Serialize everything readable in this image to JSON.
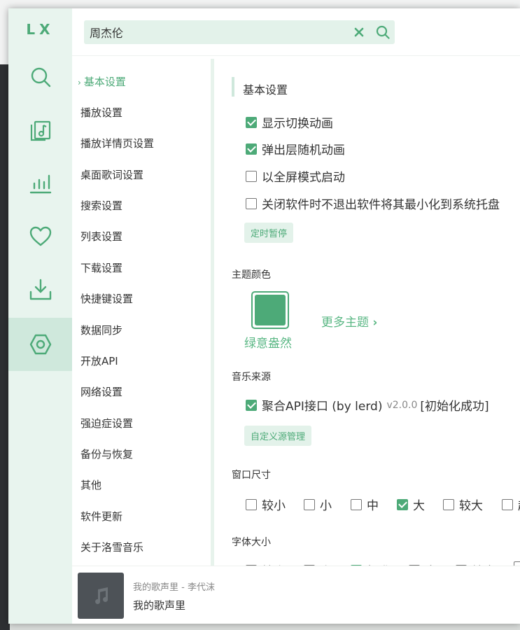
{
  "app": {
    "logo": "LX",
    "accent": "#4daa78",
    "accent_light": "#e3f2ea"
  },
  "nav": [
    {
      "name": "search",
      "icon": "search-icon"
    },
    {
      "name": "songlist",
      "icon": "music-note-icon"
    },
    {
      "name": "leaderboard",
      "icon": "bar-chart-icon"
    },
    {
      "name": "my-list",
      "icon": "heart-icon"
    },
    {
      "name": "download",
      "icon": "download-icon"
    },
    {
      "name": "settings",
      "icon": "settings-hexagon-icon",
      "active": true
    }
  ],
  "search": {
    "value": "周杰伦",
    "clear_icon": "close-icon",
    "search_icon": "search-icon"
  },
  "menu": {
    "items": [
      {
        "label": "基本设置",
        "active": true
      },
      {
        "label": "播放设置"
      },
      {
        "label": "播放详情页设置"
      },
      {
        "label": "桌面歌词设置"
      },
      {
        "label": "搜索设置"
      },
      {
        "label": "列表设置"
      },
      {
        "label": "下载设置"
      },
      {
        "label": "快捷键设置"
      },
      {
        "label": "数据同步"
      },
      {
        "label": "开放API"
      },
      {
        "label": "网络设置"
      },
      {
        "label": "强迫症设置"
      },
      {
        "label": "备份与恢复"
      },
      {
        "label": "其他"
      },
      {
        "label": "软件更新"
      },
      {
        "label": "关于洛雪音乐"
      }
    ]
  },
  "basic": {
    "title": "基本设置",
    "options": [
      {
        "label": "显示切换动画",
        "checked": true
      },
      {
        "label": "弹出层随机动画",
        "checked": true
      },
      {
        "label": "以全屏模式启动",
        "checked": false
      },
      {
        "label": "关闭软件时不退出软件将其最小化到系统托盘",
        "checked": false
      }
    ],
    "timer_button": "定时暂停"
  },
  "theme": {
    "label": "主题颜色",
    "current_name": "绿意盎然",
    "current_color": "#4daa78",
    "more_label": "更多主题"
  },
  "source": {
    "label": "音乐来源",
    "name": "聚合API接口 (by lerd)",
    "version": "v2.0.0",
    "status": "[初始化成功]",
    "checked": true,
    "manage_button": "自定义源管理"
  },
  "window_size": {
    "label": "窗口尺寸",
    "options": [
      {
        "label": "较小",
        "checked": false
      },
      {
        "label": "小",
        "checked": false
      },
      {
        "label": "中",
        "checked": false
      },
      {
        "label": "大",
        "checked": true
      },
      {
        "label": "较大",
        "checked": false
      },
      {
        "label": "超",
        "checked": false
      }
    ]
  },
  "font_size": {
    "label": "字体大小",
    "options": [
      {
        "label": "较小",
        "checked": false
      },
      {
        "label": "小",
        "checked": false
      },
      {
        "label": "标准",
        "checked": true
      },
      {
        "label": "大",
        "checked": false
      },
      {
        "label": "较大",
        "checked": false
      },
      {
        "label": "",
        "checked": false
      }
    ]
  },
  "player": {
    "subtitle": "我的歌声里 - 李代沫",
    "title": "我的歌声里",
    "cover_icon": "music-note-icon"
  }
}
